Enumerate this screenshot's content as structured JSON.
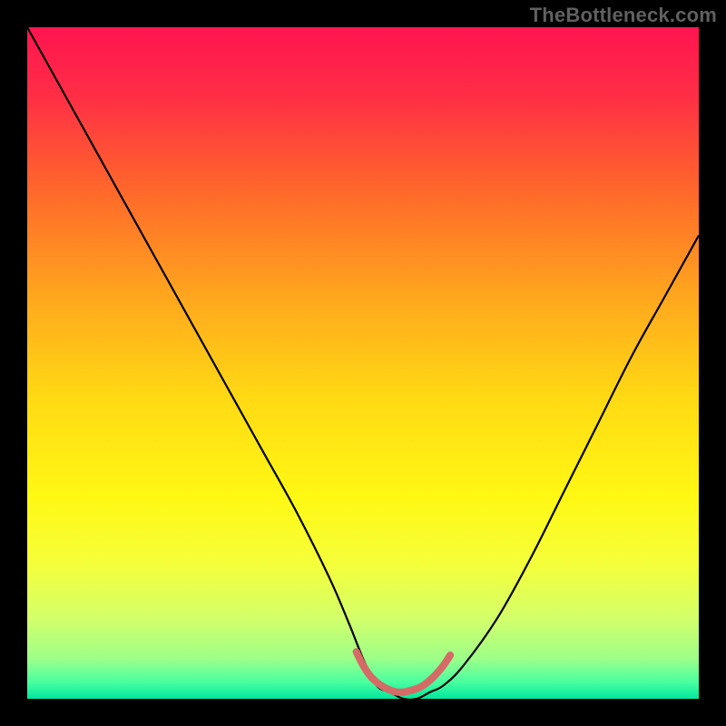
{
  "watermark": "TheBottleneck.com",
  "chart_data": {
    "type": "line",
    "title": "",
    "xlabel": "",
    "ylabel": "",
    "xlim": [
      0,
      100
    ],
    "ylim": [
      0,
      100
    ],
    "series": [
      {
        "name": "bottleneck-curve",
        "x": [
          0,
          5,
          10,
          15,
          20,
          25,
          30,
          35,
          40,
          45,
          48,
          50,
          52,
          54,
          56,
          58,
          60,
          62,
          65,
          70,
          75,
          80,
          85,
          90,
          95,
          100
        ],
        "y": [
          100,
          91,
          82,
          73,
          64,
          55,
          46,
          37,
          28,
          18,
          11,
          6,
          2,
          1,
          0,
          0,
          1,
          2,
          5,
          12,
          21,
          31,
          41,
          51,
          60,
          69
        ]
      },
      {
        "name": "optimal-zone",
        "x": [
          49,
          50,
          51,
          52,
          53,
          54,
          55,
          56,
          57,
          58,
          59,
          60,
          61,
          62,
          63
        ],
        "y": [
          7,
          5,
          3.5,
          2.5,
          1.8,
          1.3,
          1,
          1,
          1.2,
          1.5,
          2,
          2.8,
          3.8,
          5,
          6.5
        ]
      }
    ],
    "gradient_stops": [
      {
        "offset": 0.0,
        "color": "#ff1450"
      },
      {
        "offset": 0.1,
        "color": "#ff2d46"
      },
      {
        "offset": 0.25,
        "color": "#ff6a2a"
      },
      {
        "offset": 0.4,
        "color": "#ffa61e"
      },
      {
        "offset": 0.55,
        "color": "#ffd914"
      },
      {
        "offset": 0.7,
        "color": "#fff814"
      },
      {
        "offset": 0.8,
        "color": "#f4ff3a"
      },
      {
        "offset": 0.88,
        "color": "#d4ff6a"
      },
      {
        "offset": 0.94,
        "color": "#9dff88"
      },
      {
        "offset": 0.975,
        "color": "#4affa0"
      },
      {
        "offset": 1.0,
        "color": "#00e89e"
      }
    ],
    "curve_stroke": "#000000",
    "zone_stroke": "#d56a66"
  }
}
